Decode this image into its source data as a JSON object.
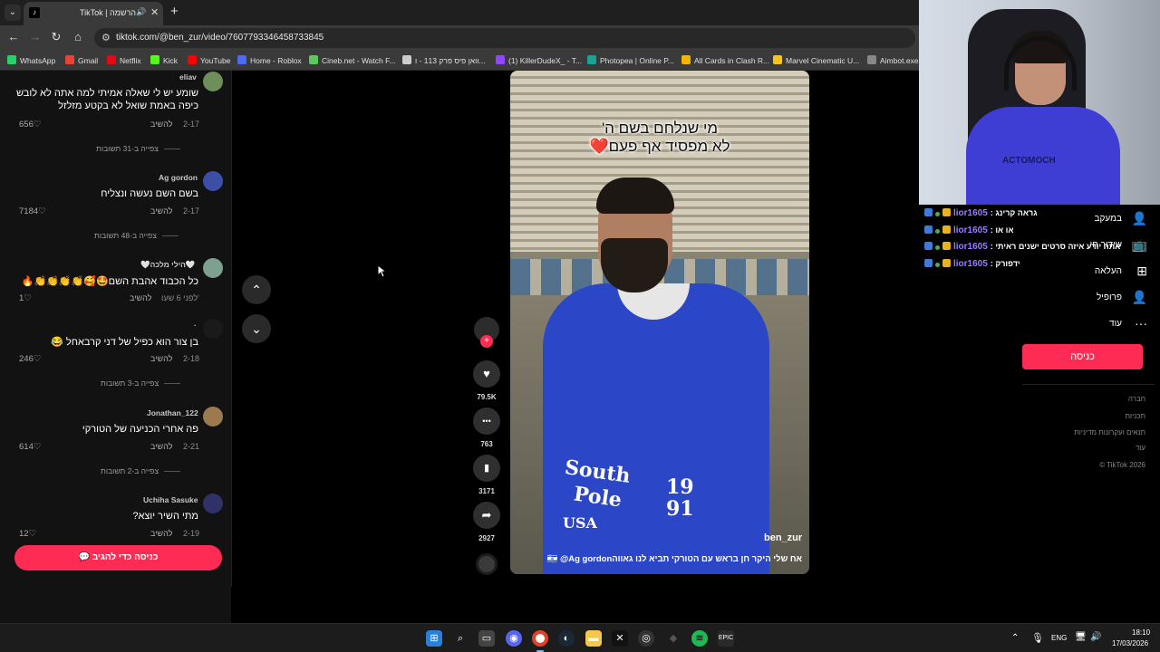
{
  "browser": {
    "tab": {
      "title": "TikTok | הרשמה",
      "close": "✕"
    },
    "new_tab": "+",
    "nav": {
      "back": "←",
      "forward": "→",
      "reload": "↻",
      "home": "⌂"
    },
    "url": "tiktok.com/@ben_zur/video/7607793346458733845",
    "bookmarks": [
      {
        "label": "WhatsApp",
        "color": "#25d366"
      },
      {
        "label": "Gmail",
        "color": "#ea4335"
      },
      {
        "label": "Netflix",
        "color": "#e50914"
      },
      {
        "label": "Kick",
        "color": "#53fc18"
      },
      {
        "label": "YouTube",
        "color": "#ff0000"
      },
      {
        "label": "Home - Roblox",
        "color": "#4a6cf7"
      },
      {
        "label": "Cineb.net - Watch F...",
        "color": "#5bc85b"
      },
      {
        "label": "וואן פיס פרק 113 - ו...",
        "color": "#cccccc"
      },
      {
        "label": "(1) KillerDudeX_ - T...",
        "color": "#9146ff"
      },
      {
        "label": "Photopea | Online P...",
        "color": "#18a497"
      },
      {
        "label": "All Cards in Clash R...",
        "color": "#f4b400"
      },
      {
        "label": "Marvel Cinematic U...",
        "color": "#f5c518"
      },
      {
        "label": "Aimbot.exe",
        "color": "#888888"
      }
    ]
  },
  "comments": {
    "items": [
      {
        "user": "eliav",
        "text1": "שומע יש לי שאלה אמיתי למה אתה לא לובש",
        "text2": "כיפה באמת שואל לא בקטע מזלזל",
        "date": "2-17",
        "reply": "להשיב",
        "likes": "656♡",
        "more": "צפייה ב-31 תשובות"
      },
      {
        "user": "Ag gordon",
        "text1": "בשם השם נעשה ונצליח",
        "date": "2-17",
        "reply": "להשיב",
        "likes": "7184♡",
        "more": "צפייה ב-48 תשובות"
      },
      {
        "user": "🤍הילי מלכה🤍",
        "text1": "כל הכבוד אהבת השם🤩🥰👏👏👏👏🔥",
        "date": "לפני 6 שעו'",
        "reply": "להשיב",
        "likes": "1♡"
      },
      {
        "user": ".",
        "text1": "בן צור הוא כפיל של דני קרבאחל 😂",
        "date": "2-18",
        "reply": "להשיב",
        "likes": "246♡",
        "more": "צפייה ב-3 תשובות"
      },
      {
        "user": "Jonathan_122",
        "text1": "פה אחרי הכניעה של הטורקי",
        "date": "2-21",
        "reply": "להשיב",
        "likes": "614♡",
        "more": "צפייה ב-2 תשובות"
      },
      {
        "user": "Uchiha Sasuke",
        "text1": "מתי השיר יוצא?",
        "date": "2-19",
        "reply": "להשיב",
        "likes": "12♡"
      }
    ],
    "login_button": "💬 כניסה כדי להגיב"
  },
  "nav_arrows": {
    "up": "⌃",
    "down": "⌄"
  },
  "video": {
    "caption_line1": "מי שנלחם בשם ה'",
    "caption_line2": "לא מפסיד אף פעם❤️",
    "author": "ben_zur",
    "description": "אח שלי היקר חן בראש עם הטורקי תביא לנו גאווה🇮🇱 @Ag gordon",
    "jacket_text": {
      "south": "South",
      "pole": "Pole",
      "year": "19 91",
      "usa": "USA"
    }
  },
  "actions": {
    "follow": "+",
    "like": {
      "icon": "♥",
      "count": "79.5K"
    },
    "comment": {
      "icon": "•••",
      "count": "763"
    },
    "save": {
      "icon": "▮",
      "count": "3171"
    },
    "share": {
      "icon": "➦",
      "count": "2927"
    }
  },
  "webcam": {
    "shirt_text": "ACTOMOCH"
  },
  "chat": [
    {
      "user": "lior1605",
      "text": ": גראה קרינג"
    },
    {
      "user": "lior1605",
      "text": ": או או"
    },
    {
      "user": "lior1605",
      "text": ": אתה יודע איזה סרטים ישנים ראיתי"
    },
    {
      "user": "lior1605",
      "text": ": ידפורק"
    }
  ],
  "sidebar": {
    "items": [
      {
        "label": "במעקב",
        "icon": "👤"
      },
      {
        "label": "שידור חי",
        "icon": "📺"
      },
      {
        "label": "העלאה",
        "icon": "⊞"
      },
      {
        "label": "פרופיל",
        "icon": "👤"
      },
      {
        "label": "עוד",
        "icon": "···"
      }
    ],
    "login": "כניסה",
    "footer": [
      "חברה",
      "תכניות",
      "תנאים ועקרונות מדיניות",
      "עוד",
      "© TikTok 2026"
    ]
  },
  "taskbar": {
    "lang": "ENG",
    "time": "18:10",
    "date": "17/03/2026"
  }
}
